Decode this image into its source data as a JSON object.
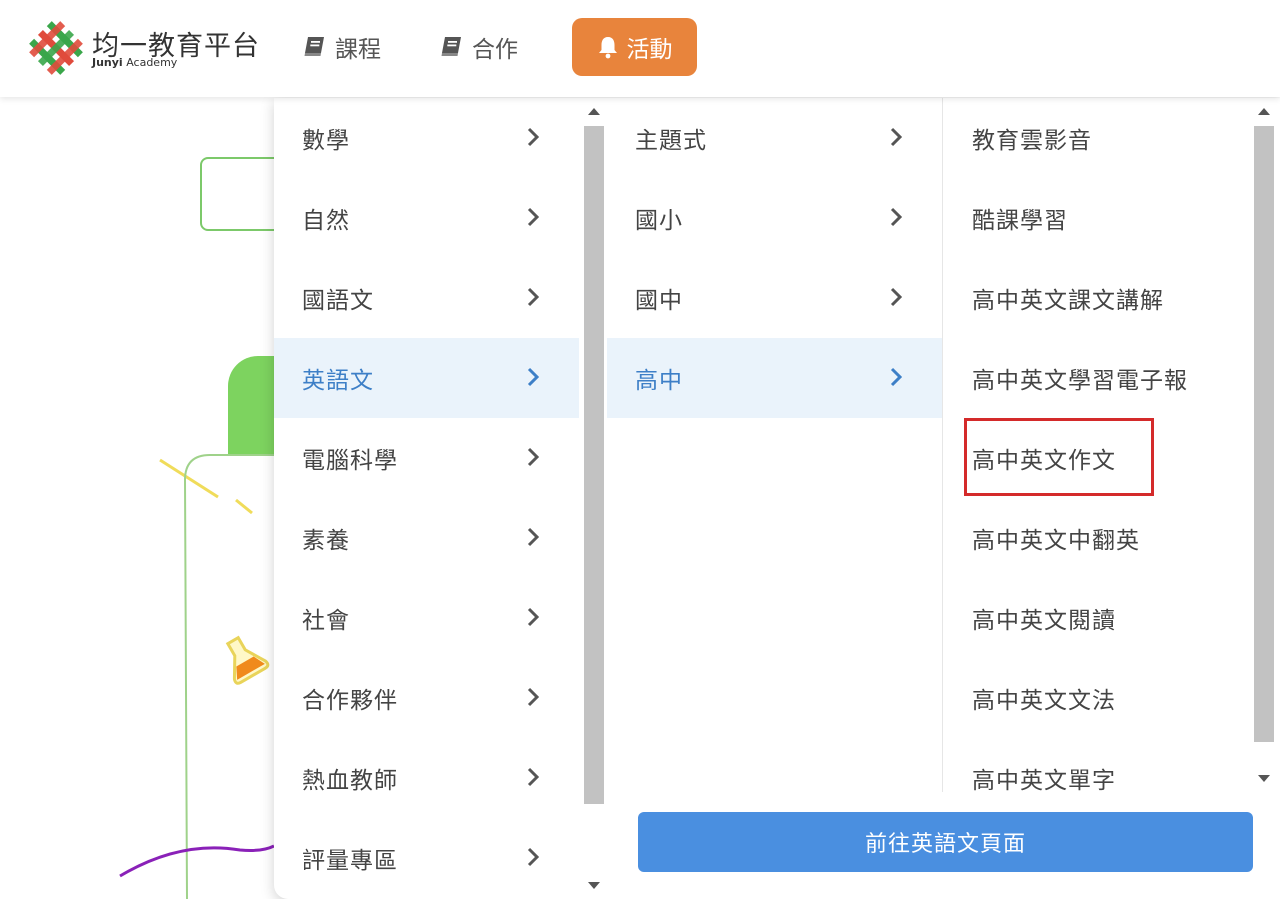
{
  "header": {
    "logo_title": "均一教育平台",
    "logo_sub_bold": "Junyi",
    "logo_sub_rest": " Academy",
    "nav": {
      "courses": "課程",
      "cooperation": "合作",
      "activity": "活動"
    }
  },
  "colors": {
    "accent_orange": "#e8843c",
    "active_blue": "#3d7fc7",
    "button_blue": "#4a8fe0",
    "highlight_red": "#d42a2a"
  },
  "menu": {
    "subjects": [
      "數學",
      "自然",
      "國語文",
      "英語文",
      "電腦科學",
      "素養",
      "社會",
      "合作夥伴",
      "熱血教師",
      "評量專區"
    ],
    "subjects_active": "英語文",
    "levels": [
      "主題式",
      "國小",
      "國中",
      "高中"
    ],
    "levels_active": "高中",
    "courses": [
      "教育雲影音",
      "酷課學習",
      "高中英文課文講解",
      "高中英文學習電子報",
      "高中英文作文",
      "高中英文中翻英",
      "高中英文閱讀",
      "高中英文文法",
      "高中英文單字"
    ],
    "courses_highlighted": "高中英文作文",
    "go_button": "前往英語文頁面"
  }
}
